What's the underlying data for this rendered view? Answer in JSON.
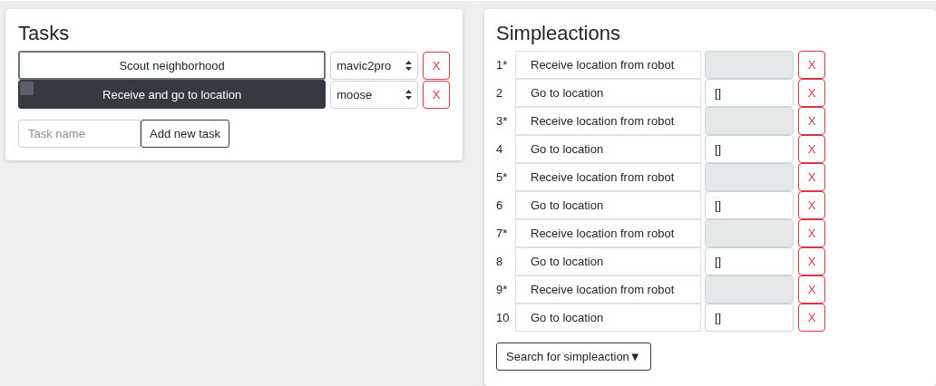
{
  "tasks_panel": {
    "title": "Tasks",
    "tasks": [
      {
        "name": "Scout neighborhood",
        "selected": false,
        "robot": "mavic2pro",
        "delete": "X"
      },
      {
        "name": "Receive and go to location",
        "selected": true,
        "robot": "moose",
        "delete": "X"
      }
    ],
    "new_task": {
      "placeholder": "Task name",
      "button": "Add new task"
    }
  },
  "simpleactions_panel": {
    "title": "Simpleactions",
    "actions": [
      {
        "index": "1*",
        "name": "Receive location from robot",
        "disabled": true,
        "delete": "X"
      },
      {
        "index": "2",
        "name": "Go to location",
        "disabled": false,
        "value": "[]",
        "delete": "X"
      },
      {
        "index": "3*",
        "name": "Receive location from robot",
        "disabled": true,
        "delete": "X"
      },
      {
        "index": "4",
        "name": "Go to location",
        "disabled": false,
        "value": "[]",
        "delete": "X"
      },
      {
        "index": "5*",
        "name": "Receive location from robot",
        "disabled": true,
        "delete": "X"
      },
      {
        "index": "6",
        "name": "Go to location",
        "disabled": false,
        "value": "[]",
        "delete": "X"
      },
      {
        "index": "7*",
        "name": "Receive location from robot",
        "disabled": true,
        "delete": "X"
      },
      {
        "index": "8",
        "name": "Go to location",
        "disabled": false,
        "value": "[]",
        "delete": "X"
      },
      {
        "index": "9*",
        "name": "Receive location from robot",
        "disabled": true,
        "delete": "X"
      },
      {
        "index": "10",
        "name": "Go to location",
        "disabled": false,
        "value": "[]",
        "delete": "X"
      }
    ],
    "search_button": "Search for simpleaction▼"
  }
}
